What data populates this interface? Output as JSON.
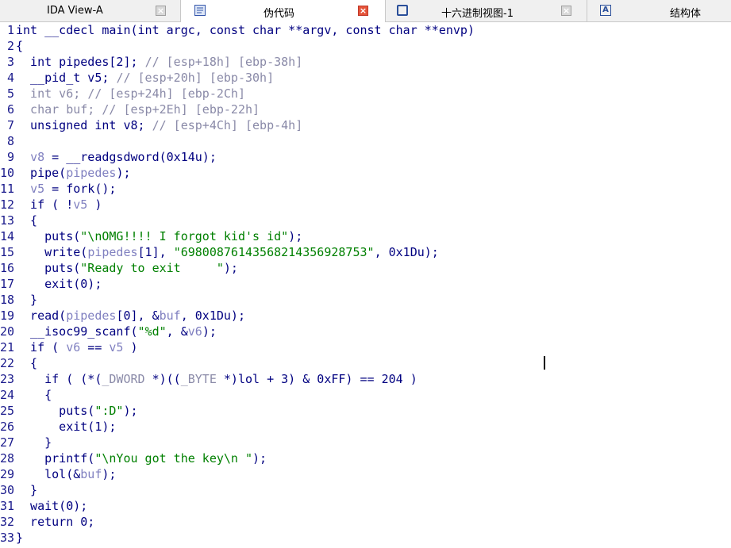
{
  "tabs": [
    {
      "label": "IDA View-A",
      "icon": "ida-view-icon",
      "active": false
    },
    {
      "label": "伪代码",
      "icon": "pseudocode-icon",
      "active": true
    },
    {
      "label": "十六进制视图-1",
      "icon": "hex-view-icon",
      "active": false
    },
    {
      "label": "结构体",
      "icon": "structures-icon",
      "active": false
    }
  ],
  "colors": {
    "code": "#000080",
    "comment": "#8a8aa8",
    "string": "#008000",
    "variable": "#8080c0",
    "line_number": "#1a1a8c"
  },
  "code_lines": [
    {
      "n": "1",
      "tokens": [
        {
          "t": "int __cdecl main(int argc, const char **argv, const char **envp)",
          "c": "code"
        }
      ]
    },
    {
      "n": "2",
      "tokens": [
        {
          "t": "{",
          "c": "code"
        }
      ]
    },
    {
      "n": "3",
      "tokens": [
        {
          "t": "  int pipedes[2]; ",
          "c": "code"
        },
        {
          "t": "// [esp+18h] [ebp-38h]",
          "c": "comment"
        }
      ]
    },
    {
      "n": "4",
      "tokens": [
        {
          "t": "  __pid_t v5; ",
          "c": "code"
        },
        {
          "t": "// [esp+20h] [ebp-30h]",
          "c": "comment"
        }
      ]
    },
    {
      "n": "5",
      "tokens": [
        {
          "t": "  int v6; ",
          "c": "comment"
        },
        {
          "t": "// [esp+24h] [ebp-2Ch]",
          "c": "comment"
        }
      ]
    },
    {
      "n": "6",
      "tokens": [
        {
          "t": "  char buf; ",
          "c": "comment"
        },
        {
          "t": "// [esp+2Eh] [ebp-22h]",
          "c": "comment"
        }
      ]
    },
    {
      "n": "7",
      "tokens": [
        {
          "t": "  unsigned int v8; ",
          "c": "code"
        },
        {
          "t": "// [esp+4Ch] [ebp-4h]",
          "c": "comment"
        }
      ]
    },
    {
      "n": "8",
      "tokens": [
        {
          "t": "",
          "c": "code"
        }
      ]
    },
    {
      "n": "9",
      "tokens": [
        {
          "t": "  ",
          "c": "code"
        },
        {
          "t": "v8",
          "c": "variable"
        },
        {
          "t": " = __readgsdword(0x14u);",
          "c": "code"
        }
      ]
    },
    {
      "n": "10",
      "tokens": [
        {
          "t": "  pipe(",
          "c": "code"
        },
        {
          "t": "pipedes",
          "c": "variable"
        },
        {
          "t": ");",
          "c": "code"
        }
      ]
    },
    {
      "n": "11",
      "tokens": [
        {
          "t": "  ",
          "c": "code"
        },
        {
          "t": "v5",
          "c": "variable"
        },
        {
          "t": " = fork();",
          "c": "code"
        }
      ]
    },
    {
      "n": "12",
      "tokens": [
        {
          "t": "  if ( !",
          "c": "code"
        },
        {
          "t": "v5",
          "c": "variable"
        },
        {
          "t": " )",
          "c": "code"
        }
      ]
    },
    {
      "n": "13",
      "tokens": [
        {
          "t": "  {",
          "c": "code"
        }
      ]
    },
    {
      "n": "14",
      "tokens": [
        {
          "t": "    puts(",
          "c": "code"
        },
        {
          "t": "\"\\nOMG!!!! I forgot kid's id\"",
          "c": "string"
        },
        {
          "t": ");",
          "c": "code"
        }
      ]
    },
    {
      "n": "15",
      "tokens": [
        {
          "t": "    write(",
          "c": "code"
        },
        {
          "t": "pipedes",
          "c": "variable"
        },
        {
          "t": "[1], ",
          "c": "code"
        },
        {
          "t": "\"69800876143568214356928753\"",
          "c": "string"
        },
        {
          "t": ", 0x1Du);",
          "c": "code"
        }
      ]
    },
    {
      "n": "16",
      "tokens": [
        {
          "t": "    puts(",
          "c": "code"
        },
        {
          "t": "\"Ready to exit     \"",
          "c": "string"
        },
        {
          "t": ");",
          "c": "code"
        }
      ]
    },
    {
      "n": "17",
      "tokens": [
        {
          "t": "    exit(0);",
          "c": "code"
        }
      ]
    },
    {
      "n": "18",
      "tokens": [
        {
          "t": "  }",
          "c": "code"
        }
      ]
    },
    {
      "n": "19",
      "tokens": [
        {
          "t": "  read(",
          "c": "code"
        },
        {
          "t": "pipedes",
          "c": "variable"
        },
        {
          "t": "[0], &",
          "c": "code"
        },
        {
          "t": "buf",
          "c": "variable"
        },
        {
          "t": ", 0x1Du);",
          "c": "code"
        }
      ]
    },
    {
      "n": "20",
      "tokens": [
        {
          "t": "  __isoc99_scanf(",
          "c": "code"
        },
        {
          "t": "\"%d\"",
          "c": "string"
        },
        {
          "t": ", &",
          "c": "code"
        },
        {
          "t": "v6",
          "c": "variable"
        },
        {
          "t": ");",
          "c": "code"
        }
      ]
    },
    {
      "n": "21",
      "tokens": [
        {
          "t": "  if ( ",
          "c": "code"
        },
        {
          "t": "v6",
          "c": "variable"
        },
        {
          "t": " == ",
          "c": "code"
        },
        {
          "t": "v5",
          "c": "variable"
        },
        {
          "t": " )",
          "c": "code"
        }
      ]
    },
    {
      "n": "22",
      "tokens": [
        {
          "t": "  {",
          "c": "code"
        }
      ]
    },
    {
      "n": "23",
      "tokens": [
        {
          "t": "    if ( (*(",
          "c": "code"
        },
        {
          "t": "_DWORD",
          "c": "comment"
        },
        {
          "t": " *)((",
          "c": "code"
        },
        {
          "t": "_BYTE",
          "c": "comment"
        },
        {
          "t": " *)lol + 3) & 0xFF) == 204 )",
          "c": "code"
        }
      ]
    },
    {
      "n": "24",
      "tokens": [
        {
          "t": "    {",
          "c": "code"
        }
      ]
    },
    {
      "n": "25",
      "tokens": [
        {
          "t": "      puts(",
          "c": "code"
        },
        {
          "t": "\":D\"",
          "c": "string"
        },
        {
          "t": ");",
          "c": "code"
        }
      ]
    },
    {
      "n": "26",
      "tokens": [
        {
          "t": "      exit(1);",
          "c": "code"
        }
      ]
    },
    {
      "n": "27",
      "tokens": [
        {
          "t": "    }",
          "c": "code"
        }
      ]
    },
    {
      "n": "28",
      "tokens": [
        {
          "t": "    printf(",
          "c": "code"
        },
        {
          "t": "\"\\nYou got the key\\n \"",
          "c": "string"
        },
        {
          "t": ");",
          "c": "code"
        }
      ]
    },
    {
      "n": "29",
      "tokens": [
        {
          "t": "    lol(&",
          "c": "code"
        },
        {
          "t": "buf",
          "c": "variable"
        },
        {
          "t": ");",
          "c": "code"
        }
      ]
    },
    {
      "n": "30",
      "tokens": [
        {
          "t": "  }",
          "c": "code"
        }
      ]
    },
    {
      "n": "31",
      "tokens": [
        {
          "t": "  wait(0);",
          "c": "code"
        }
      ]
    },
    {
      "n": "32",
      "tokens": [
        {
          "t": "  return 0;",
          "c": "code"
        }
      ]
    },
    {
      "n": "33",
      "tokens": [
        {
          "t": "}",
          "c": "code"
        }
      ]
    }
  ]
}
